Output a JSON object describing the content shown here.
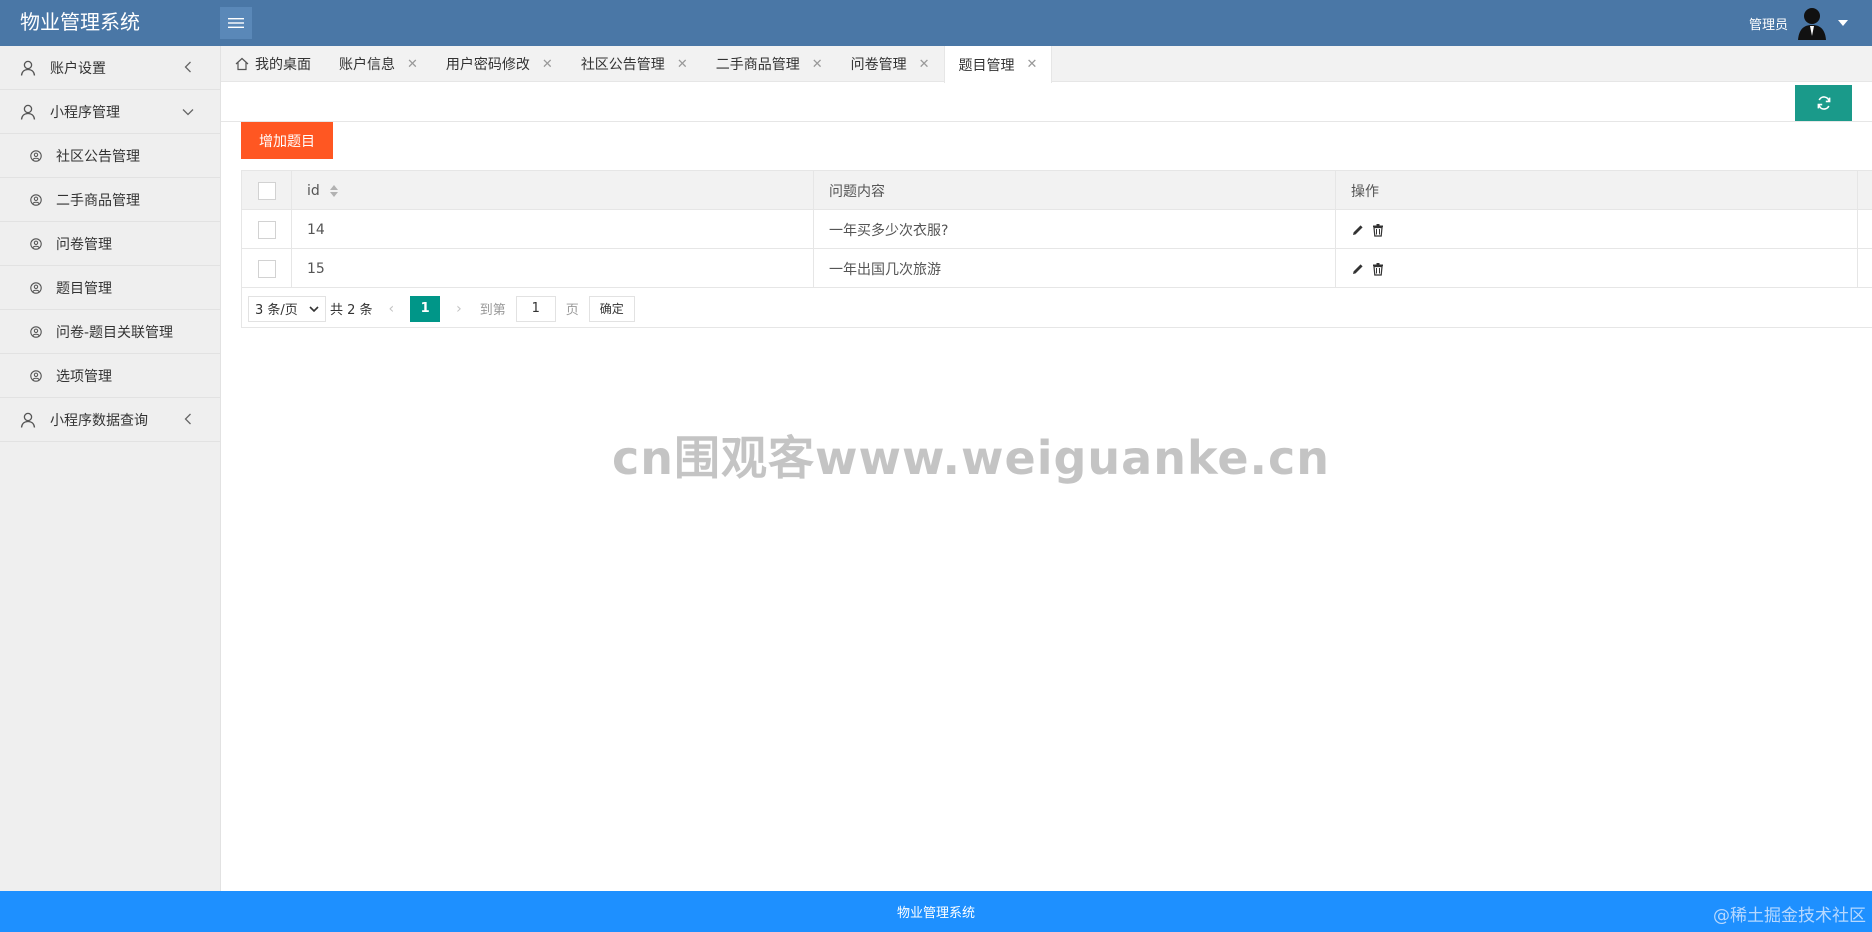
{
  "header": {
    "title": "物业管理系统",
    "menu_toggle_icon": "hamburger-icon",
    "user_name": "管理员",
    "avatar_icon": "user-avatar-icon",
    "dropdown_icon": "caret-down-icon"
  },
  "sidebar": {
    "groups": [
      {
        "label": "账户设置",
        "icon": "user-icon",
        "expanded": false
      },
      {
        "label": "小程序管理",
        "icon": "user-icon",
        "expanded": true
      },
      {
        "label": "小程序数据查询",
        "icon": "user-icon",
        "expanded": false
      }
    ],
    "items": [
      {
        "label": "社区公告管理",
        "icon": "user-circle-icon"
      },
      {
        "label": "二手商品管理",
        "icon": "user-circle-icon"
      },
      {
        "label": "问卷管理",
        "icon": "user-circle-icon"
      },
      {
        "label": "题目管理",
        "icon": "user-circle-icon"
      },
      {
        "label": "问卷-题目关联管理",
        "icon": "user-circle-icon"
      },
      {
        "label": "选项管理",
        "icon": "user-circle-icon"
      }
    ]
  },
  "tabs": [
    {
      "label": "我的桌面",
      "closable": false,
      "active": false
    },
    {
      "label": "账户信息",
      "closable": true,
      "active": false
    },
    {
      "label": "用户密码修改",
      "closable": true,
      "active": false
    },
    {
      "label": "社区公告管理",
      "closable": true,
      "active": false
    },
    {
      "label": "二手商品管理",
      "closable": true,
      "active": false
    },
    {
      "label": "问卷管理",
      "closable": true,
      "active": false
    },
    {
      "label": "题目管理",
      "closable": true,
      "active": true
    }
  ],
  "toolbar": {
    "add_label": "增加题目",
    "refresh_icon": "refresh-icon"
  },
  "table": {
    "columns": [
      "id",
      "问题内容",
      "操作"
    ],
    "rows": [
      {
        "id": "14",
        "question": "一年买多少次衣服?"
      },
      {
        "id": "15",
        "question": "一年出国几次旅游"
      }
    ],
    "edit_icon": "pencil-icon",
    "delete_icon": "trash-icon"
  },
  "pager": {
    "per_page": "3 条/页",
    "total": "共 2 条",
    "current_page": "1",
    "goto_label": "到第",
    "goto_value": "1",
    "page_word": "页",
    "confirm_label": "确定"
  },
  "watermark": "cn围观客www.weiguanke.cn",
  "footer": {
    "text": "物业管理系统",
    "credit": "@稀土掘金技术社区"
  },
  "colors": {
    "header_bg": "#4a77a6",
    "footer_bg": "#1e90ff",
    "add_button": "#ff5722",
    "refresh_button": "#1a9a8a",
    "pager_active": "#009688"
  }
}
